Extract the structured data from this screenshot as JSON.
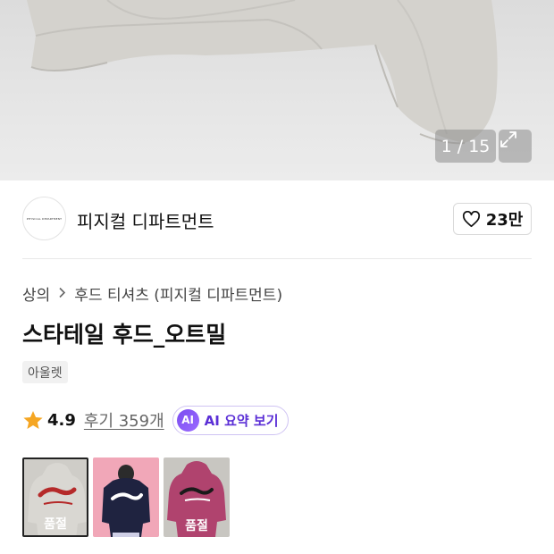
{
  "gallery": {
    "counter": "1 / 15",
    "expand_icon": "expand-icon"
  },
  "brand": {
    "logo_text": "PHYSICAL DEPARTMENT",
    "name": "피지컬 디파트먼트",
    "likes": "23만"
  },
  "breadcrumb": {
    "items": [
      "상의",
      "후드 티셔츠 (피지컬 디파트먼트)"
    ],
    "separator_icon": "chevron-right-icon"
  },
  "product": {
    "title": "스타테일 후드_오트밀",
    "tag": "아울렛"
  },
  "rating": {
    "score": "4.9",
    "reviews": "후기 359개",
    "ai_badge": "AI",
    "ai_label": "AI 요약 보기"
  },
  "swatches": [
    {
      "color": "#d9d7d2",
      "status": "품절",
      "selected": true
    },
    {
      "color": "#1f2340",
      "status": "",
      "selected": false
    },
    {
      "color": "#b0436e",
      "status": "품절",
      "selected": false
    }
  ],
  "colors": {
    "accent": "#5b2fd6",
    "star": "#f5a623"
  }
}
